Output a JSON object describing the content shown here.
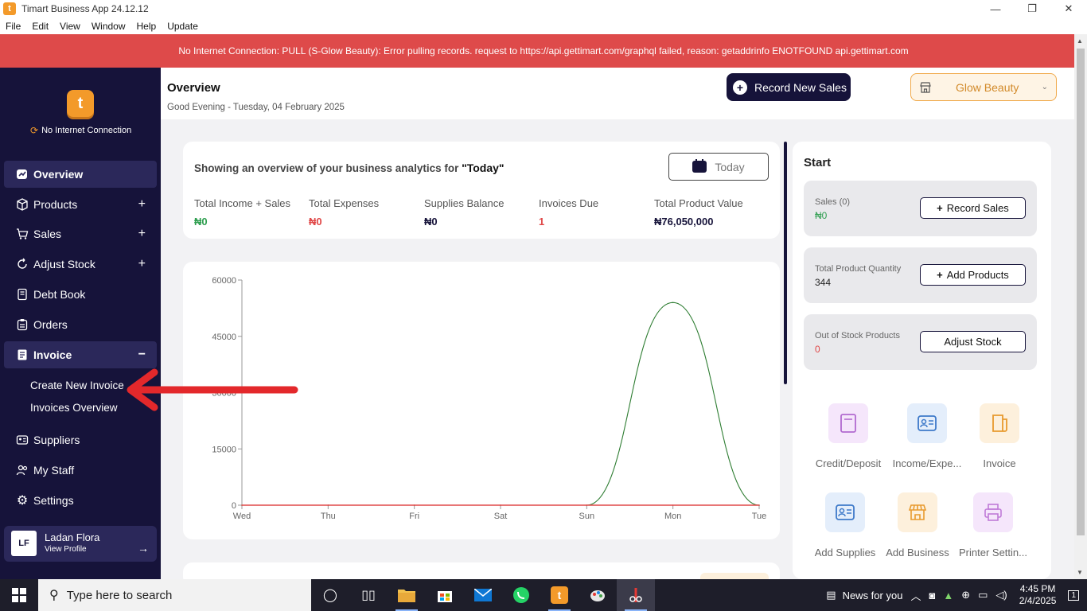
{
  "window": {
    "title": "Timart Business App 24.12.12",
    "minimize": "—",
    "maximize": "❐",
    "close": "✕"
  },
  "menu": [
    "File",
    "Edit",
    "View",
    "Window",
    "Help",
    "Update"
  ],
  "banner": {
    "text": "No Internet Connection: PULL (S-Glow Beauty): Error pulling records. request to https://api.gettimart.com/graphql failed, reason: getaddrinfo ENOTFOUND api.gettimart.com",
    "color": "#de4a4a"
  },
  "sidebar": {
    "logo_letter": "t",
    "connection_status": "No Internet Connection",
    "items": [
      {
        "label": "Overview",
        "icon": "overview-icon",
        "active": true
      },
      {
        "label": "Products",
        "icon": "box-icon",
        "expand": "+"
      },
      {
        "label": "Sales",
        "icon": "cart-icon",
        "expand": "+"
      },
      {
        "label": "Adjust Stock",
        "icon": "refresh-icon",
        "expand": "+"
      },
      {
        "label": "Debt Book",
        "icon": "book-icon"
      },
      {
        "label": "Orders",
        "icon": "clipboard-icon"
      },
      {
        "label": "Invoice",
        "icon": "invoice-icon",
        "expand": "−",
        "active": true
      },
      {
        "label": "Suppliers",
        "icon": "id-card-icon"
      },
      {
        "label": "My Staff",
        "icon": "people-icon"
      },
      {
        "label": "Settings",
        "icon": "gear-icon"
      }
    ],
    "invoice_subitems": [
      "Create New Invoice",
      "Invoices Overview"
    ],
    "profile": {
      "initials": "LF",
      "name": "Ladan Flora",
      "link": "View Profile"
    }
  },
  "header": {
    "title": "Overview",
    "greeting": "Good Evening - Tuesday, 04 February 2025",
    "record_button": "Record New Sales",
    "store": "Glow Beauty"
  },
  "analytics": {
    "title_prefix": "Showing an overview of your business analytics for ",
    "title_period": "\"Today\"",
    "period_button": "Today",
    "stats": [
      {
        "label": "Total Income + Sales",
        "value": "₦0",
        "color": "#2e9e4f"
      },
      {
        "label": "Total Expenses",
        "value": "₦0",
        "color": "#e04848"
      },
      {
        "label": "Supplies Balance",
        "value": "₦0",
        "color": "#16133a"
      },
      {
        "label": "Invoices Due",
        "value": "1",
        "color": "#e04848"
      },
      {
        "label": "Total Product Value",
        "value": "₦76,050,000",
        "color": "#16133a"
      }
    ]
  },
  "chart_data": {
    "type": "line",
    "categories": [
      "Wed",
      "Thu",
      "Fri",
      "Sat",
      "Sun",
      "Mon",
      "Tue"
    ],
    "series": [
      {
        "values": [
          0,
          0,
          0,
          0,
          0,
          54000,
          0
        ],
        "color": "#2e7d32"
      },
      {
        "values": [
          0,
          0,
          0,
          0,
          0,
          0,
          0
        ],
        "color": "#e04848"
      }
    ],
    "ylim": [
      0,
      60000
    ],
    "yticks": [
      "60000",
      "45000",
      "30000",
      "15000",
      "0"
    ],
    "grid": false
  },
  "start": {
    "title": "Start",
    "cards": [
      {
        "label": "Sales (0)",
        "value": "₦0",
        "value_color": "#2e9e4f",
        "button": "Record Sales",
        "button_icon": "+"
      },
      {
        "label": "Total Product Quantity",
        "value": "344",
        "value_color": "#222",
        "button": "Add Products",
        "button_icon": "+"
      },
      {
        "label": "Out of Stock Products",
        "value": "0",
        "value_color": "#e04848",
        "button": "Adjust Stock",
        "button_icon": ""
      }
    ],
    "tiles": [
      {
        "label": "Credit/Deposit",
        "icon": "book-icon",
        "bg": "#f5e6fb",
        "fg": "#b26ad0"
      },
      {
        "label": "Income/Expe...",
        "icon": "id-card-icon",
        "bg": "#e4eefb",
        "fg": "#3d79c9"
      },
      {
        "label": "Invoice",
        "icon": "invoice-icon",
        "bg": "#fdf0dc",
        "fg": "#e89a2e"
      },
      {
        "label": "Add Supplies",
        "icon": "id-card-icon",
        "bg": "#e4eefb",
        "fg": "#3d79c9"
      },
      {
        "label": "Add Business",
        "icon": "store-icon",
        "bg": "#fdf0dc",
        "fg": "#e89a2e"
      },
      {
        "label": "Printer Settin...",
        "icon": "printer-icon",
        "bg": "#f5e6fb",
        "fg": "#c07ad8"
      }
    ]
  },
  "taskbar": {
    "search_placeholder": "Type here to search",
    "news": "News for you",
    "time": "4:45 PM",
    "date": "2/4/2025",
    "notifications": "1"
  }
}
